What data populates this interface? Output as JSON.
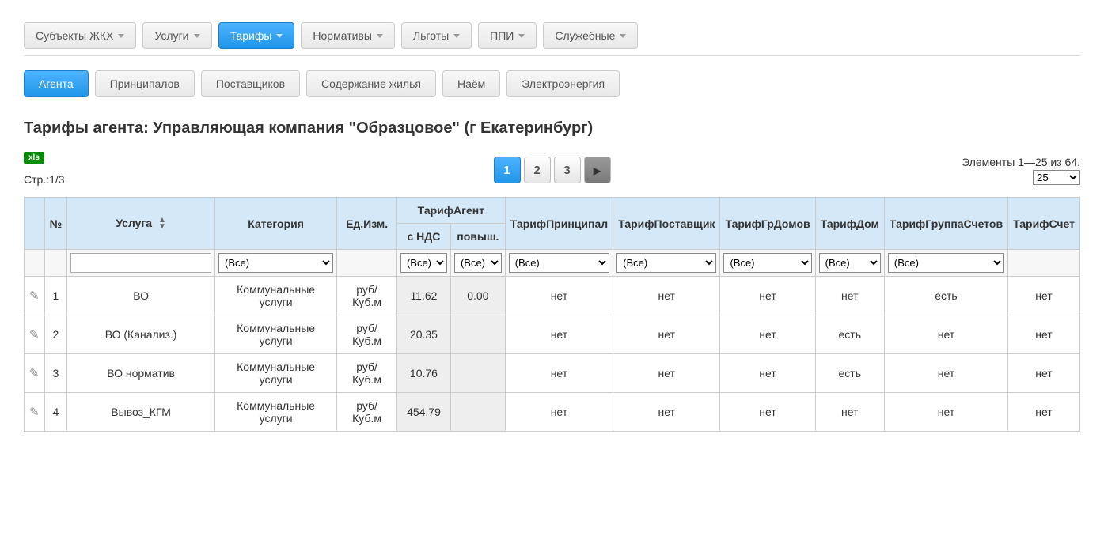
{
  "nav": {
    "items": [
      {
        "label": "Субъекты ЖКХ",
        "active": false,
        "caret": true
      },
      {
        "label": "Услуги",
        "active": false,
        "caret": true
      },
      {
        "label": "Тарифы",
        "active": true,
        "caret": true
      },
      {
        "label": "Нормативы",
        "active": false,
        "caret": true
      },
      {
        "label": "Льготы",
        "active": false,
        "caret": true
      },
      {
        "label": "ППИ",
        "active": false,
        "caret": true
      },
      {
        "label": "Служебные",
        "active": false,
        "caret": true
      }
    ]
  },
  "subnav": {
    "items": [
      {
        "label": "Агента",
        "active": true
      },
      {
        "label": "Принципалов",
        "active": false
      },
      {
        "label": "Поставщиков",
        "active": false
      },
      {
        "label": "Содержание жилья",
        "active": false
      },
      {
        "label": "Наём",
        "active": false
      },
      {
        "label": "Электроэнергия",
        "active": false
      }
    ]
  },
  "page_title": "Тарифы агента: Управляющая компания \"Образцовое\" (г Екатеринбург)",
  "export_label": "xls",
  "page_counter": "Стр.:1/3",
  "pager": {
    "pages": [
      "1",
      "2",
      "3"
    ],
    "active": "1"
  },
  "elements_info": "Элементы 1—25 из 64.",
  "page_size": "25",
  "headers": {
    "num": "№",
    "service": "Услуга",
    "category": "Категория",
    "unit": "Ед.Изм.",
    "tariff_agent": "ТарифАгент",
    "with_vat": "с НДС",
    "increase": "повыш.",
    "tariff_principal": "ТарифПринципал",
    "tariff_supplier": "ТарифПоставщик",
    "tariff_houses": "ТарифГрДомов",
    "tariff_house": "ТарифДом",
    "tariff_accounts_group": "ТарифГруппаСчетов",
    "tariff_account": "ТарифСчет"
  },
  "filters": {
    "all": "(Все)"
  },
  "rows": [
    {
      "num": "1",
      "service": "ВО",
      "category": "Коммунальные услуги",
      "unit": "руб/Куб.м",
      "vat": "11.62",
      "inc": "0.00",
      "principal": "нет",
      "supplier": "нет",
      "houses": "нет",
      "house": "нет",
      "accgroup": "есть",
      "acc": "нет"
    },
    {
      "num": "2",
      "service": "ВО (Канализ.)",
      "category": "Коммунальные услуги",
      "unit": "руб/Куб.м",
      "vat": "20.35",
      "inc": "",
      "principal": "нет",
      "supplier": "нет",
      "houses": "нет",
      "house": "есть",
      "accgroup": "нет",
      "acc": "нет"
    },
    {
      "num": "3",
      "service": "ВО норматив",
      "category": "Коммунальные услуги",
      "unit": "руб/Куб.м",
      "vat": "10.76",
      "inc": "",
      "principal": "нет",
      "supplier": "нет",
      "houses": "нет",
      "house": "есть",
      "accgroup": "нет",
      "acc": "нет"
    },
    {
      "num": "4",
      "service": "Вывоз_КГМ",
      "category": "Коммунальные услуги",
      "unit": "руб/Куб.м",
      "vat": "454.79",
      "inc": "",
      "principal": "нет",
      "supplier": "нет",
      "houses": "нет",
      "house": "нет",
      "accgroup": "нет",
      "acc": "нет"
    }
  ]
}
